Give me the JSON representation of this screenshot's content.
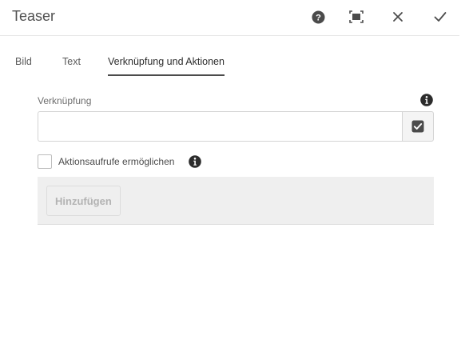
{
  "dialog": {
    "title": "Teaser",
    "icons": {
      "help": "help-icon",
      "fullscreen": "fullscreen-icon",
      "close": "close-icon",
      "done": "checkmark-icon"
    }
  },
  "tabs": [
    {
      "label": "Bild",
      "active": false
    },
    {
      "label": "Text",
      "active": false
    },
    {
      "label": "Verknüpfung und Aktionen",
      "active": true
    }
  ],
  "link_field": {
    "label": "Verknüpfung",
    "value": "",
    "placeholder": ""
  },
  "call_to_action": {
    "label": "Aktionsaufrufe ermöglichen",
    "checked": false
  },
  "actions_panel": {
    "add_label": "Hinzufügen",
    "disabled": true
  },
  "colors": {
    "icon": "#4b4b4b",
    "panel_bg": "#efefef",
    "border": "#d3d3d3"
  }
}
